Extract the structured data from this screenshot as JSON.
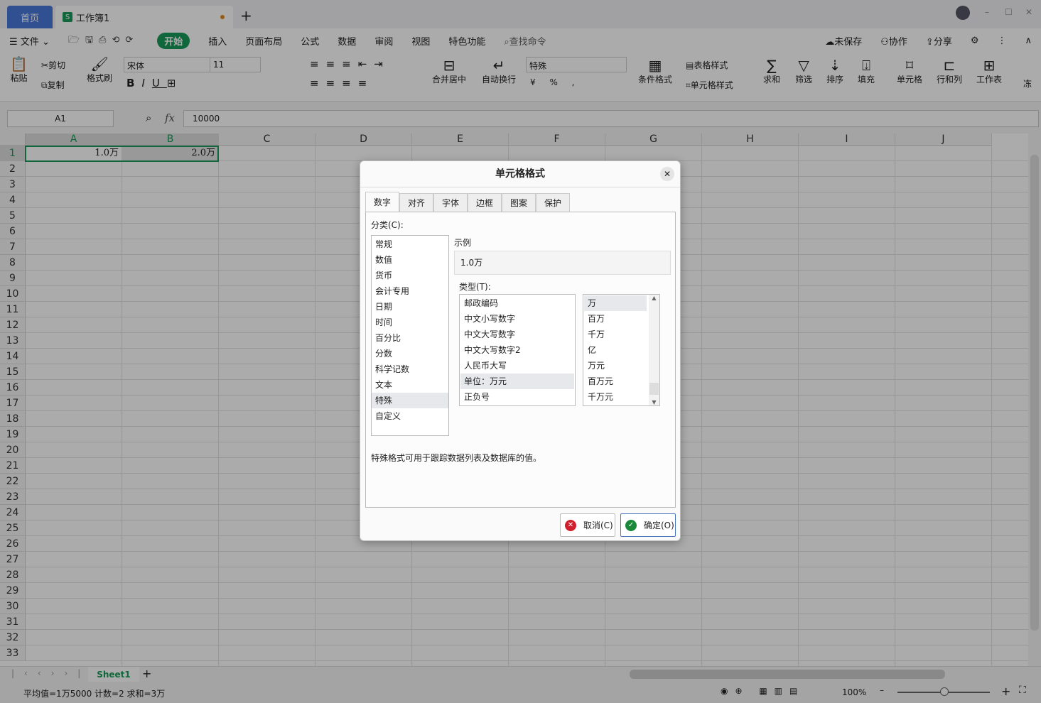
{
  "tabs": {
    "home": "首页",
    "doc": "工作簿1",
    "new": "+"
  },
  "window": {
    "min": "–",
    "max": "☐",
    "close": "✕"
  },
  "menu": {
    "file": "文件",
    "items": [
      "开始",
      "插入",
      "页面布局",
      "公式",
      "数据",
      "审阅",
      "视图",
      "特色功能"
    ],
    "search": "查找命令",
    "unsaved": "未保存",
    "collab": "协作",
    "share": "分享"
  },
  "ribbon": {
    "paste": "粘贴",
    "cut": "剪切",
    "copy": "复制",
    "format_painter": "格式刷",
    "font": "宋体",
    "size": "11",
    "merge": "合并居中",
    "wrap": "自动换行",
    "numfmt": "特殊",
    "cond": "条件格式",
    "table_style": "表格样式",
    "cell_style": "单元格样式",
    "sum": "求和",
    "filter": "筛选",
    "sort": "排序",
    "fill": "填充",
    "cell": "单元格",
    "rowcol": "行和列",
    "sheet": "工作表",
    "freeze": "冻"
  },
  "formula": {
    "namebox": "A1",
    "fx": "fx",
    "value": "10000"
  },
  "columns": [
    "A",
    "B",
    "C",
    "D",
    "E",
    "F",
    "G",
    "H",
    "I",
    "J"
  ],
  "rows": [
    "1",
    "2",
    "3",
    "4",
    "5",
    "6",
    "7",
    "8",
    "9",
    "10",
    "11",
    "12",
    "13",
    "14",
    "15",
    "16",
    "17",
    "18",
    "19",
    "20",
    "21",
    "22",
    "23",
    "24",
    "25",
    "26",
    "27",
    "28",
    "29",
    "30",
    "31",
    "32",
    "33"
  ],
  "cells": {
    "A1": "1.0万",
    "B1": "2.0万"
  },
  "sheet_tab": "Sheet1",
  "status": {
    "summary": "平均值=1万5000  计数=2  求和=3万",
    "zoom": "100%"
  },
  "dialog": {
    "title": "单元格格式",
    "tabs": [
      "数字",
      "对齐",
      "字体",
      "边框",
      "图案",
      "保护"
    ],
    "category_label": "分类(C):",
    "categories": [
      "常规",
      "数值",
      "货币",
      "会计专用",
      "日期",
      "时间",
      "百分比",
      "分数",
      "科学记数",
      "文本",
      "特殊",
      "自定义"
    ],
    "selected_category": "特殊",
    "sample_label": "示例",
    "sample": "1.0万",
    "type_label": "类型(T):",
    "types": [
      "邮政编码",
      "中文小写数字",
      "中文大写数字",
      "中文大写数字2",
      "人民币大写",
      "单位：万元",
      "正负号"
    ],
    "selected_type": "单位：万元",
    "units": [
      "万",
      "百万",
      "千万",
      "亿",
      "万元",
      "百万元",
      "千万元"
    ],
    "selected_unit": "万",
    "description": "特殊格式可用于跟踪数据列表及数据库的值。",
    "cancel": "取消(C)",
    "ok": "确定(O)"
  },
  "colors": {
    "accent": "#1a9a5a",
    "home_tab": "#4a78d8",
    "cancel": "#d0202e",
    "ok": "#1a8a3a"
  }
}
